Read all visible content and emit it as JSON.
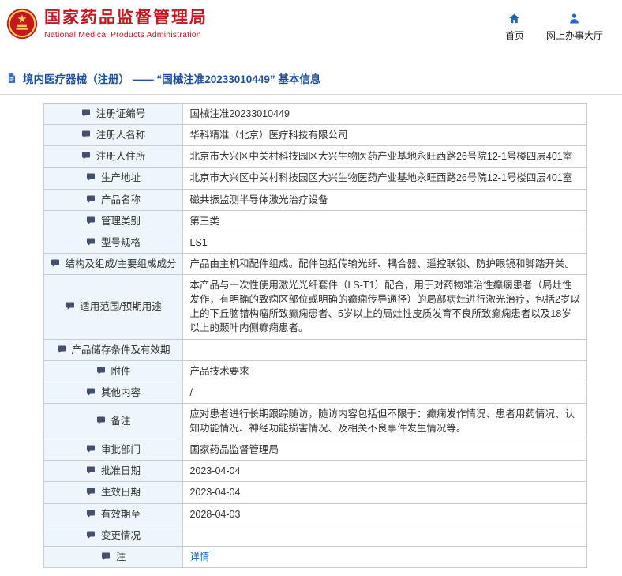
{
  "colors": {
    "brand_red": "#c7161d",
    "title_blue": "#1a4f9d",
    "nav_icon_blue": "#2166c0",
    "link_blue": "#0563c1",
    "label_bg": "#eef6fc",
    "table_border": "#cccccc"
  },
  "header": {
    "site_title": "国家药品监督管理局",
    "site_subtitle": "National Medical Products Administration",
    "nav": [
      {
        "label": "首页",
        "icon": "home-icon"
      },
      {
        "label": "网上办事大厅",
        "icon": "person-icon"
      }
    ]
  },
  "page": {
    "title": "境内医疗器械（注册） —— “国械注准20233010449” 基本信息"
  },
  "table": {
    "rows": [
      {
        "label": "注册证编号",
        "value": "国械注准20233010449"
      },
      {
        "label": "注册人名称",
        "value": "华科精准（北京）医疗科技有限公司"
      },
      {
        "label": "注册人住所",
        "value": "北京市大兴区中关村科技园区大兴生物医药产业基地永旺西路26号院12-1号楼四层401室"
      },
      {
        "label": "生产地址",
        "value": "北京市大兴区中关村科技园区大兴生物医药产业基地永旺西路26号院12-1号楼四层401室"
      },
      {
        "label": "产品名称",
        "value": "磁共振监测半导体激光治疗设备"
      },
      {
        "label": "管理类别",
        "value": "第三类"
      },
      {
        "label": "型号规格",
        "value": "LS1"
      },
      {
        "label": "结构及组成/主要组成成分",
        "value": "产品由主机和配件组成。配件包括传输光纤、耦合器、遥控联锁、防护眼镜和脚踏开关。"
      },
      {
        "label": "适用范围/预期用途",
        "value": "本产品与一次性使用激光光纤套件（LS-T1）配合，用于对药物难治性癫痫患者（局灶性发作，有明确的致痫区部位或明确的癫痫传导通径）的局部病灶进行激光治疗，包括2岁以上的下丘脑错构瘤所致癫痫患者、5岁以上的局灶性皮质发育不良所致癫痫患者以及18岁以上的颞叶内侧癫痫患者。"
      },
      {
        "label": "产品储存条件及有效期",
        "value": ""
      },
      {
        "label": "附件",
        "value": "产品技术要求"
      },
      {
        "label": "其他内容",
        "value": "/"
      },
      {
        "label": "备注",
        "value": "应对患者进行长期跟踪随访，随访内容包括但不限于：癫痫发作情况、患者用药情况、认知功能情况、神经功能损害情况、及相关不良事件发生情况等。"
      },
      {
        "label": "审批部门",
        "value": "国家药品监督管理局"
      },
      {
        "label": "批准日期",
        "value": "2023-04-04"
      },
      {
        "label": "生效日期",
        "value": "2023-04-04"
      },
      {
        "label": "有效期至",
        "value": "2028-04-03"
      },
      {
        "label": "变更情况",
        "value": ""
      },
      {
        "label": "注",
        "value": "详情",
        "link": true,
        "icon": "note-icon"
      }
    ]
  }
}
